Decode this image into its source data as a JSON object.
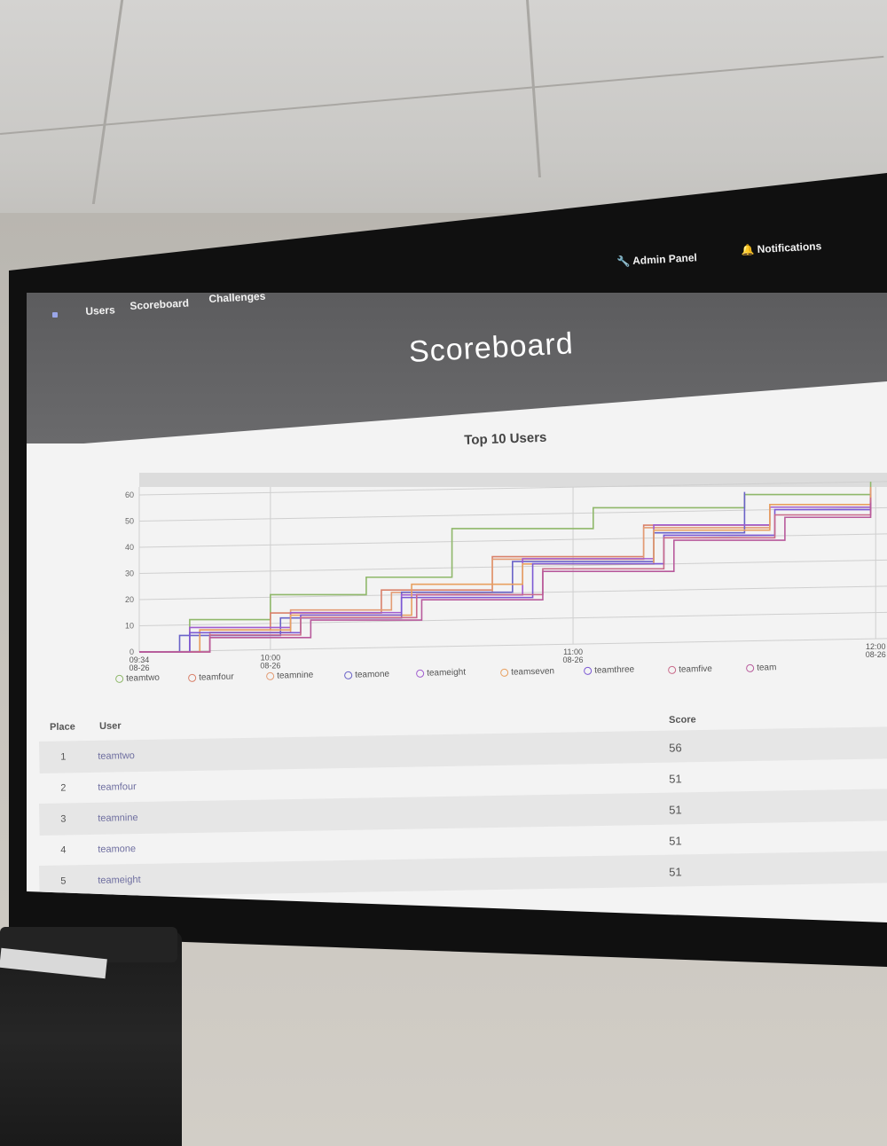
{
  "nav": {
    "links": [
      "Users",
      "Scoreboard",
      "Challenges"
    ],
    "admin_panel": "Admin Panel",
    "notifications": "Notifications"
  },
  "page": {
    "title": "Scoreboard"
  },
  "chart_title": "Top 10 Users",
  "chart_data": {
    "type": "line",
    "title": "Top 10 Users",
    "ylim": [
      0,
      60
    ],
    "yticks": [
      "0",
      "10",
      "20",
      "30",
      "40",
      "50",
      "60"
    ],
    "xticks": [
      {
        "time": "09:34",
        "date": "08-26"
      },
      {
        "time": "10:00",
        "date": "08-26"
      },
      {
        "time": "11:00",
        "date": "08-26"
      },
      {
        "time": "12:00",
        "date": "08-26"
      }
    ],
    "series": [
      {
        "name": "teamtwo",
        "color": "#8fb86a",
        "values": [
          [
            0,
            0
          ],
          [
            10,
            12
          ],
          [
            26,
            21
          ],
          [
            45,
            27
          ],
          [
            62,
            45
          ],
          [
            90,
            52
          ],
          [
            120,
            56
          ],
          [
            145,
            60
          ]
        ]
      },
      {
        "name": "teamfour",
        "color": "#d9816b",
        "values": [
          [
            0,
            0
          ],
          [
            12,
            8
          ],
          [
            26,
            14
          ],
          [
            48,
            22
          ],
          [
            70,
            34
          ],
          [
            100,
            45
          ],
          [
            125,
            51
          ],
          [
            145,
            57
          ]
        ]
      },
      {
        "name": "teamnine",
        "color": "#e39c74",
        "values": [
          [
            0,
            0
          ],
          [
            14,
            7
          ],
          [
            30,
            15
          ],
          [
            50,
            21
          ],
          [
            70,
            33
          ],
          [
            100,
            44
          ],
          [
            125,
            51
          ],
          [
            145,
            58
          ]
        ]
      },
      {
        "name": "teamone",
        "color": "#6a63c8",
        "values": [
          [
            0,
            0
          ],
          [
            8,
            6
          ],
          [
            28,
            12
          ],
          [
            52,
            21
          ],
          [
            74,
            32
          ],
          [
            102,
            42
          ],
          [
            120,
            57
          ]
        ]
      },
      {
        "name": "teameight",
        "color": "#a05ccf",
        "values": [
          [
            0,
            0
          ],
          [
            10,
            9
          ],
          [
            30,
            14
          ],
          [
            52,
            20
          ],
          [
            76,
            33
          ],
          [
            102,
            45
          ],
          [
            125,
            51
          ],
          [
            145,
            55
          ]
        ]
      },
      {
        "name": "teamseven",
        "color": "#e8a060",
        "values": [
          [
            0,
            0
          ],
          [
            12,
            8
          ],
          [
            30,
            13
          ],
          [
            54,
            24
          ],
          [
            76,
            31
          ],
          [
            102,
            43
          ],
          [
            125,
            52
          ],
          [
            145,
            55
          ]
        ]
      },
      {
        "name": "teamthree",
        "color": "#7b58d4",
        "values": [
          [
            0,
            0
          ],
          [
            10,
            7
          ],
          [
            32,
            13
          ],
          [
            52,
            19
          ],
          [
            78,
            31
          ],
          [
            104,
            41
          ],
          [
            126,
            50
          ],
          [
            145,
            53
          ]
        ]
      },
      {
        "name": "teamfive",
        "color": "#c96a8a",
        "values": [
          [
            0,
            0
          ],
          [
            14,
            6
          ],
          [
            32,
            12
          ],
          [
            55,
            20
          ],
          [
            80,
            29
          ],
          [
            104,
            40
          ],
          [
            126,
            48
          ],
          [
            145,
            54
          ]
        ]
      },
      {
        "name": "teamsix",
        "color": "#b85a9c",
        "values": [
          [
            0,
            0
          ],
          [
            14,
            5
          ],
          [
            34,
            11
          ],
          [
            56,
            18
          ],
          [
            80,
            28
          ],
          [
            106,
            39
          ],
          [
            128,
            47
          ],
          [
            145,
            52
          ]
        ]
      }
    ],
    "legend_visible": [
      "teamtwo",
      "teamfour",
      "teamnine",
      "teamone",
      "teameight",
      "teamseven",
      "teamthree",
      "teamfive",
      "team"
    ]
  },
  "table": {
    "headers": {
      "place": "Place",
      "user": "User",
      "score": "Score"
    },
    "rows": [
      {
        "place": "1",
        "user": "teamtwo",
        "score": "56"
      },
      {
        "place": "2",
        "user": "teamfour",
        "score": "51"
      },
      {
        "place": "3",
        "user": "teamnine",
        "score": "51"
      },
      {
        "place": "4",
        "user": "teamone",
        "score": "51"
      },
      {
        "place": "5",
        "user": "teameight",
        "score": "51"
      }
    ]
  }
}
